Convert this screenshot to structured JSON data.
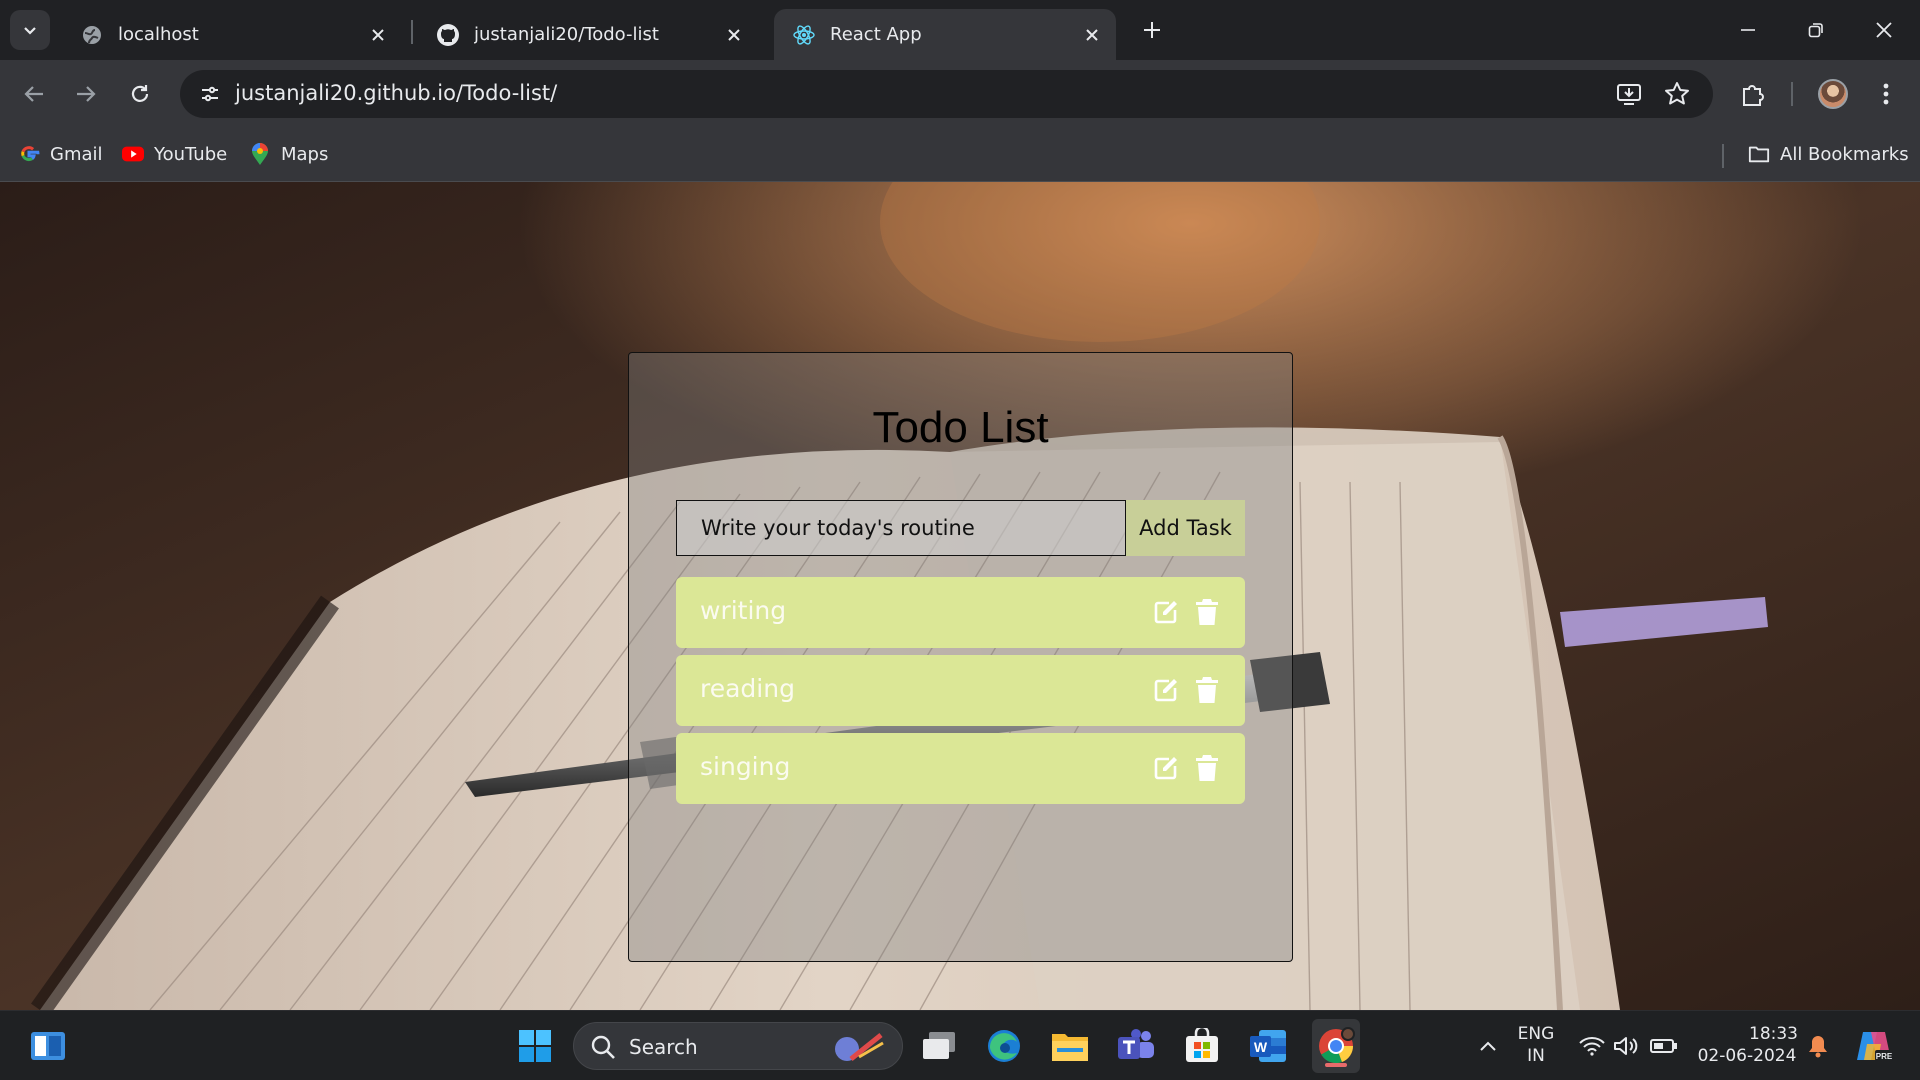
{
  "browser": {
    "tabs": [
      {
        "title": "localhost",
        "icon": "globe-icon"
      },
      {
        "title": "justanjali20/Todo-list",
        "icon": "github-icon"
      },
      {
        "title": "React App",
        "icon": "react-icon",
        "active": true
      }
    ],
    "url": "justanjali20.github.io/Todo-list/",
    "bookmarks": [
      {
        "label": "Gmail",
        "icon": "google-icon"
      },
      {
        "label": "YouTube",
        "icon": "youtube-icon"
      },
      {
        "label": "Maps",
        "icon": "maps-icon"
      }
    ],
    "all_bookmarks_label": "All Bookmarks"
  },
  "app": {
    "title": "Todo List",
    "input_placeholder": "Write your today's routine",
    "add_button_label": "Add Task",
    "todos": [
      {
        "text": "writing"
      },
      {
        "text": "reading"
      },
      {
        "text": "singing"
      }
    ],
    "colors": {
      "todo_bg": "#dbe796",
      "add_button_bg": "#c8cf98"
    }
  },
  "taskbar": {
    "search_label": "Search",
    "language": {
      "line1": "ENG",
      "line2": "IN"
    },
    "time": "18:33",
    "date": "02-06-2024"
  }
}
